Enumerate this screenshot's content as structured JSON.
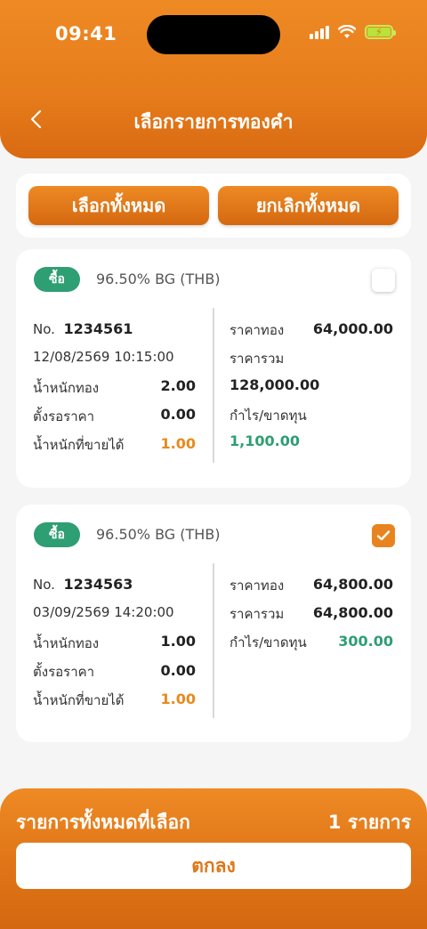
{
  "status_bar": {
    "time": "09:41"
  },
  "header": {
    "title": "เลือกรายการทองคำ"
  },
  "actions": {
    "select_all": "เลือกทั้งหมด",
    "deselect_all": "ยกเลิกทั้งหมด"
  },
  "items": [
    {
      "badge": "ซื้อ",
      "product": "96.50% BG (THB)",
      "checked": false,
      "no_label": "No.",
      "no": "1234561",
      "datetime": "12/08/2569 10:15:00",
      "weight_label": "น้ำหนักทอง",
      "weight": "2.00",
      "pending_label": "ตั้งรอราคา",
      "pending": "0.00",
      "sellable_label": "น้ำหนักที่ขายได้",
      "sellable": "1.00",
      "gold_price_label": "ราคาทอง",
      "gold_price": "64,000.00",
      "total_label": "ราคารวม",
      "total": "128,000.00",
      "pl_label": "กำไร/ขาดทุน",
      "pl": "1,100.00"
    },
    {
      "badge": "ซื้อ",
      "product": "96.50% BG (THB)",
      "checked": true,
      "no_label": "No.",
      "no": "1234563",
      "datetime": "03/09/2569 14:20:00",
      "weight_label": "น้ำหนักทอง",
      "weight": "1.00",
      "pending_label": "ตั้งรอราคา",
      "pending": "0.00",
      "sellable_label": "น้ำหนักที่ขายได้",
      "sellable": "1.00",
      "gold_price_label": "ราคาทอง",
      "gold_price": "64,800.00",
      "total_label": "ราคารวม",
      "total": "64,800.00",
      "pl_label": "กำไร/ขาดทุน",
      "pl": "300.00"
    }
  ],
  "footer": {
    "label": "รายการทั้งหมดที่เลือก",
    "count": "1 รายการ",
    "confirm": "ตกลง"
  },
  "colors": {
    "accent": "#E67C1B",
    "green": "#2E9E73",
    "orange_text": "#E88A1C"
  }
}
